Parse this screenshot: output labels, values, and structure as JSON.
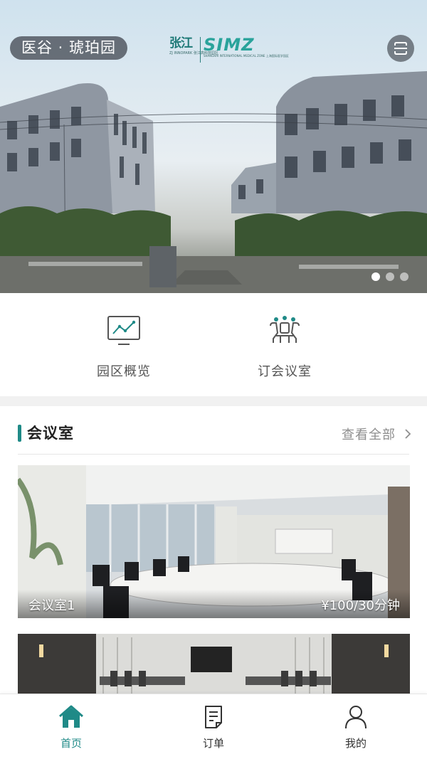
{
  "hero": {
    "park_name": "医谷 · 琥珀园",
    "logo": {
      "cn": "张江",
      "cn_sub": "ZJ INNOPARK 张江高科技园区",
      "en": "SIMZ",
      "en_sub": "SHANGHAI INTERNATIONAL MEDICAL ZONE 上海国际医学园区"
    },
    "scan_icon": "scan-icon",
    "carousel": {
      "count": 3,
      "active": 0
    }
  },
  "quick_entries": [
    {
      "label": "园区概览",
      "icon": "chart-monitor-icon"
    },
    {
      "label": "订会议室",
      "icon": "meeting-people-icon"
    }
  ],
  "meeting_section": {
    "title": "会议室",
    "view_all": "查看全部",
    "accent_color": "#1f8a87",
    "rooms": [
      {
        "name": "会议室1",
        "price": "¥100/30分钟"
      },
      {
        "name": "",
        "price": ""
      }
    ]
  },
  "tabbar": {
    "active_color": "#1f8a87",
    "tabs": [
      {
        "label": "首页",
        "icon": "home-icon",
        "active": true
      },
      {
        "label": "订单",
        "icon": "order-document-icon",
        "active": false
      },
      {
        "label": "我的",
        "icon": "user-icon",
        "active": false
      }
    ]
  }
}
